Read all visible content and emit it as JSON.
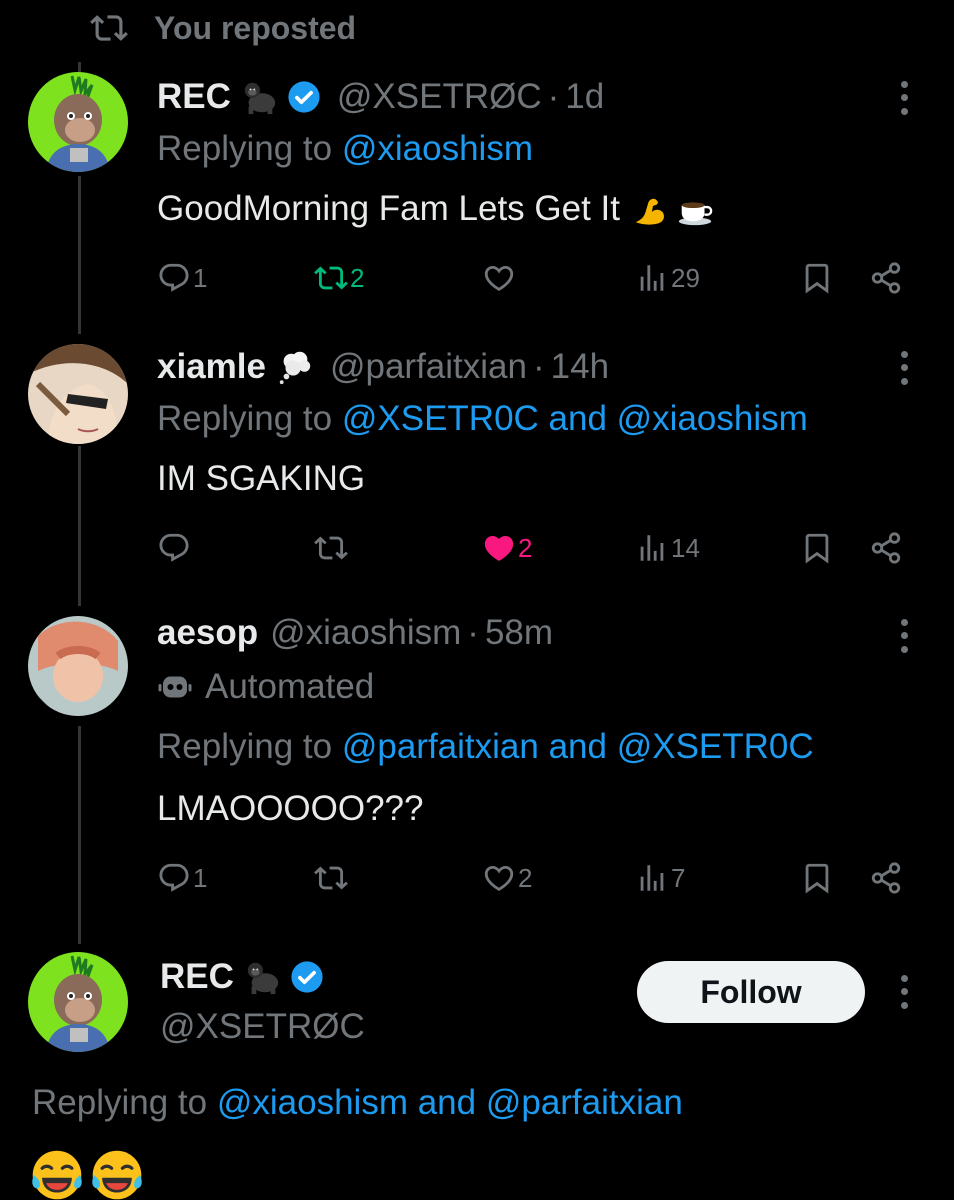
{
  "repost_header": {
    "text": "You reposted",
    "icon": "repost-icon"
  },
  "tweets": [
    {
      "display_name": "REC",
      "name_emoji": "gorilla",
      "verified": true,
      "handle": "@XSETRØC",
      "time": "1d",
      "replying_prefix": "Replying to",
      "replying_to": "@xiaoshism",
      "text": "GoodMorning Fam Lets Get It",
      "text_emojis": [
        "flexed-biceps",
        "hot-beverage"
      ],
      "actions": {
        "replies": "1",
        "reposts": "2",
        "likes": "",
        "views": "29"
      }
    },
    {
      "display_name": "xiamle",
      "name_emoji": "thought-balloon",
      "verified": false,
      "handle": "@parfaitxian",
      "time": "14h",
      "replying_prefix": "Replying to",
      "replying_to": "@XSETR0C and @xiaoshism",
      "text": "IM SGAKING",
      "actions": {
        "replies": "",
        "reposts": "",
        "likes": "2",
        "views": "14"
      }
    },
    {
      "display_name": "aesop",
      "handle": "@xiaoshism",
      "time": "58m",
      "automated_label": "Automated",
      "replying_prefix": "Replying to",
      "replying_to": "@parfaitxian and @XSETR0C",
      "text": "LMAOOOOO???",
      "actions": {
        "replies": "1",
        "reposts": "",
        "likes": "2",
        "views": "7"
      }
    }
  ],
  "main_tweet": {
    "display_name": "REC",
    "name_emoji": "gorilla",
    "verified": true,
    "handle": "@XSETRØC",
    "follow_label": "Follow",
    "replying_prefix": "Replying to",
    "replying_to": "@xiaoshism and @parfaitxian",
    "text_emojis": [
      "face-with-tears-of-joy",
      "face-with-tears-of-joy"
    ]
  },
  "colors": {
    "background": "#000000",
    "text": "#e7e9ea",
    "muted": "#71767b",
    "link": "#1d9bf0",
    "repost_active": "#00ba7c",
    "like_active": "#f91880",
    "follow_bg": "#eff3f4"
  }
}
